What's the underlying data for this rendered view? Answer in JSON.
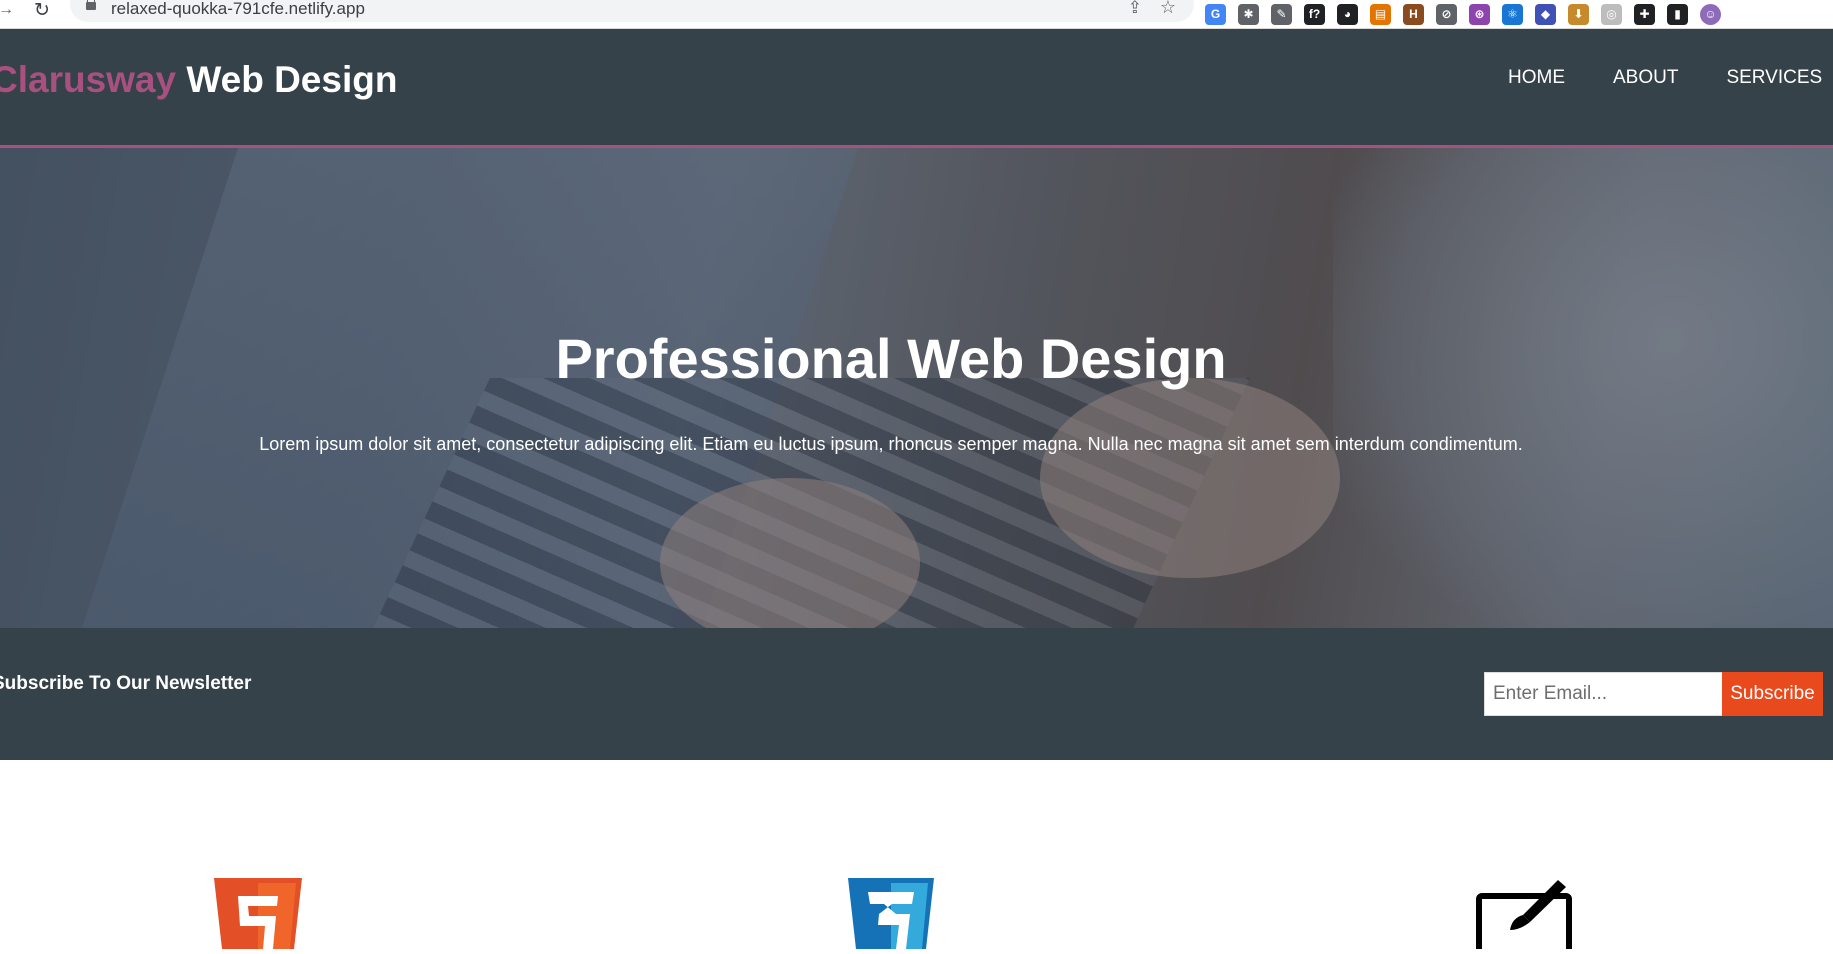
{
  "browser": {
    "url": "relaxed-quokka-791cfe.netlify.app",
    "icons": {
      "back": "back-arrow-icon",
      "reload": "reload-icon",
      "lock": "lock-icon",
      "share": "share-icon",
      "bookmark": "star-icon"
    },
    "extensions": [
      {
        "name": "translate-extension-icon",
        "glyph": "G",
        "color": "#4285f4"
      },
      {
        "name": "bug-extension-icon",
        "glyph": "✱",
        "color": "#5f6368"
      },
      {
        "name": "eyedropper-extension-icon",
        "glyph": "✎",
        "color": "#5f6368"
      },
      {
        "name": "font-extension-icon",
        "glyph": "f?",
        "color": "#202124"
      },
      {
        "name": "profile-extension-icon",
        "glyph": "◕",
        "color": "#202124"
      },
      {
        "name": "notes-extension-icon",
        "glyph": "▤",
        "color": "#e37400"
      },
      {
        "name": "html-extension-icon",
        "glyph": "H",
        "color": "#8a4b1f"
      },
      {
        "name": "compass-extension-icon",
        "glyph": "⊘",
        "color": "#5f6368"
      },
      {
        "name": "redux-extension-icon",
        "glyph": "⊛",
        "color": "#8e44ad"
      },
      {
        "name": "react-extension-icon",
        "glyph": "⚛",
        "color": "#1976d2"
      },
      {
        "name": "stack-extension-icon",
        "glyph": "◆",
        "color": "#3f51b5"
      },
      {
        "name": "download-extension-icon",
        "glyph": "⬇",
        "color": "#c68a2c"
      },
      {
        "name": "record-extension-icon",
        "glyph": "◎",
        "color": "#bdbdbd"
      },
      {
        "name": "puzzle-extensions-icon",
        "glyph": "✚",
        "color": "#202124"
      },
      {
        "name": "sidepanel-icon",
        "glyph": "▮",
        "color": "#202124"
      },
      {
        "name": "profile-avatar-icon",
        "glyph": "☺",
        "color": "#8e6bb8"
      }
    ]
  },
  "header": {
    "brand_highlight": "Clarusway",
    "brand_rest": " Web Design",
    "nav": [
      "HOME",
      "ABOUT",
      "SERVICES"
    ]
  },
  "showcase": {
    "title": "Professional Web Design",
    "text": "Lorem ipsum dolor sit amet, consectetur adipiscing elit. Etiam eu luctus ipsum, rhoncus semper magna. Nulla nec magna sit amet sem interdum condimentum."
  },
  "newsletter": {
    "title": "Subscribe To Our Newsletter",
    "placeholder": "Enter Email...",
    "button": "Subscribe"
  },
  "boxes": {
    "icons": [
      "html5-logo-icon",
      "css3-logo-icon",
      "brush-design-icon"
    ]
  },
  "colors": {
    "dark": "#35424a",
    "accent": "#a8507f",
    "button": "#e8491d"
  }
}
